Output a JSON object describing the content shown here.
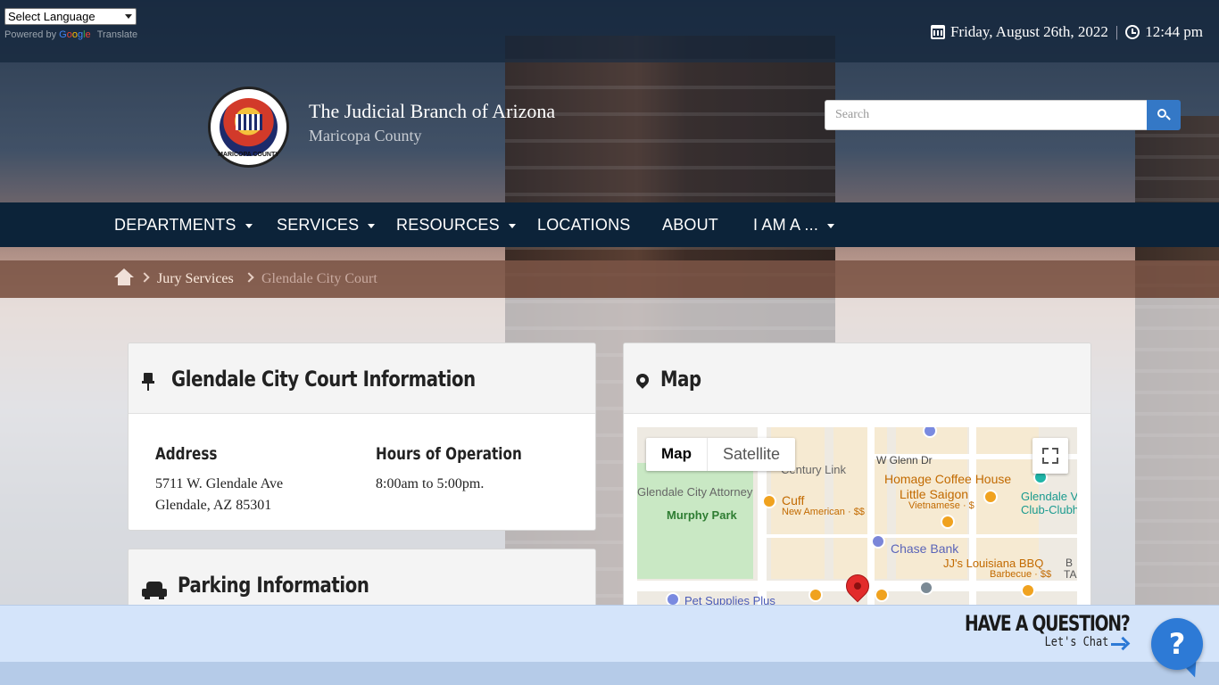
{
  "translate": {
    "select_label": "Select Language",
    "powered_by": "Powered by",
    "google": [
      "G",
      "o",
      "o",
      "g",
      "l",
      "e"
    ],
    "translate_word": "Translate"
  },
  "datetime": {
    "date": "Friday, August 26th, 2022",
    "separator": "|",
    "time": "12:44 pm"
  },
  "header": {
    "title": "The Judicial Branch of Arizona",
    "subtitle": "Maricopa County",
    "seal_text": "MARICOPA COUNTY",
    "search_placeholder": "Search"
  },
  "nav": {
    "items": [
      {
        "label": "DEPARTMENTS",
        "dropdown": true
      },
      {
        "label": "SERVICES",
        "dropdown": true
      },
      {
        "label": "RESOURCES",
        "dropdown": true
      },
      {
        "label": "LOCATIONS",
        "dropdown": false
      },
      {
        "label": "ABOUT",
        "dropdown": false
      },
      {
        "label": "I AM A ...",
        "dropdown": true
      }
    ]
  },
  "breadcrumb": {
    "link": "Jury Services",
    "current": "Glendale City Court"
  },
  "court_info": {
    "title": "Glendale City Court Information",
    "address_label": "Address",
    "address_line1": "5711 W. Glendale Ave",
    "address_line2": "Glendale, AZ 85301",
    "hours_label": "Hours of Operation",
    "hours": "8:00am to 5:00pm."
  },
  "parking": {
    "title": "Parking Information"
  },
  "map": {
    "title": "Map",
    "toggle_map": "Map",
    "toggle_satellite": "Satellite",
    "labels": {
      "century_link": "Century Link",
      "w_glenn": "W Glenn Dr",
      "glendale_attorney": "Glendale City Attorney",
      "murphy_park": "Murphy Park",
      "cuff": "Cuff",
      "cuff_sub": "New American · $$",
      "homage": "Homage Coffee House",
      "little_saigon": "Little Saigon",
      "little_saigon_sub": "Vietnamese · $",
      "glendale_club": "Glendale V",
      "glendale_club2": "Club-Clubh",
      "chase": "Chase Bank",
      "jj": "JJ's Louisiana BBQ",
      "jj_sub": "Barbecue · $$",
      "pet_supplies": "Pet Supplies Plus",
      "edge_b": "B",
      "edge_ta": "TA"
    }
  },
  "chat": {
    "title": "HAVE A QUESTION?",
    "subtitle": "Let's Chat",
    "bubble": "?"
  },
  "colors": {
    "nav_bg": "#0c2339",
    "breadcrumb_bg": "#7b5446",
    "accent_blue": "#3478c6",
    "chat_bar": "#d4e4fa"
  }
}
